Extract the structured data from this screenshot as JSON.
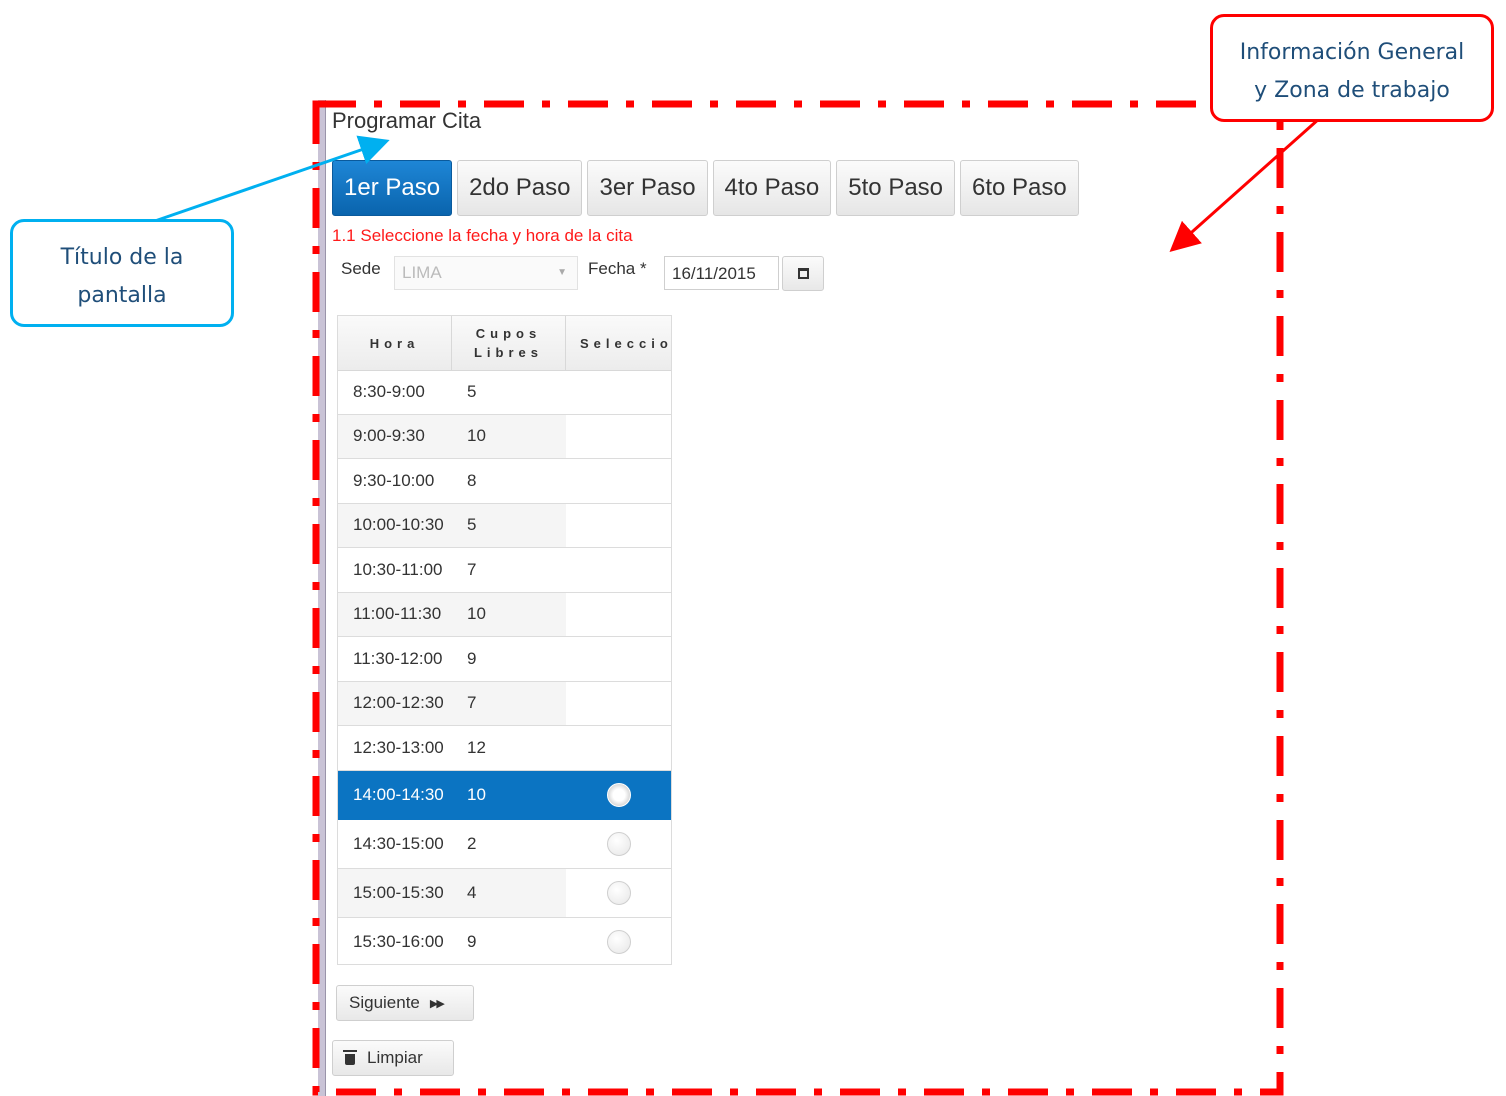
{
  "screen": {
    "title": "Programar Cita",
    "tabs": [
      {
        "label": "1er Paso",
        "active": true
      },
      {
        "label": "2do Paso"
      },
      {
        "label": "3er Paso"
      },
      {
        "label": "4to Paso"
      },
      {
        "label": "5to Paso"
      },
      {
        "label": "6to Paso"
      }
    ],
    "instruction": "1.1 Seleccione la fecha y hora de la cita",
    "sede": {
      "label": "Sede",
      "value": "LIMA"
    },
    "fecha": {
      "label": "Fecha *",
      "value": "16/11/2015"
    },
    "table": {
      "headers": [
        "Hora",
        "Cupos Libres",
        "Seleccio"
      ],
      "rows": [
        {
          "hora": "8:30-9:00",
          "cupos": "5"
        },
        {
          "hora": "9:00-9:30",
          "cupos": "10"
        },
        {
          "hora": "9:30-10:00",
          "cupos": "8"
        },
        {
          "hora": "10:00-10:30",
          "cupos": "5"
        },
        {
          "hora": "10:30-11:00",
          "cupos": "7"
        },
        {
          "hora": "11:00-11:30",
          "cupos": "10"
        },
        {
          "hora": "11:30-12:00",
          "cupos": "9"
        },
        {
          "hora": "12:00-12:30",
          "cupos": "7"
        },
        {
          "hora": "12:30-13:00",
          "cupos": "12"
        },
        {
          "hora": "14:00-14:30",
          "cupos": "10",
          "radio": true,
          "selected": true
        },
        {
          "hora": "14:30-15:00",
          "cupos": "2",
          "radio": true
        },
        {
          "hora": "15:00-15:30",
          "cupos": "4",
          "radio": true
        },
        {
          "hora": "15:30-16:00",
          "cupos": "9",
          "radio": true
        }
      ]
    },
    "next_button": "Siguiente",
    "clear_button": "Limpiar"
  },
  "annotations": {
    "title_callout": [
      "Título de la",
      "pantalla"
    ],
    "zone_callout": [
      "Información General",
      "y Zona de trabajo"
    ]
  },
  "colors": {
    "active_tab": "#0a64ad",
    "instruction": "#ff1a1a",
    "selected_row": "#0b74c2",
    "zone_border": "#ff0000",
    "title_callout": "#00b0f0",
    "zone_callout_text": "#1f4e79"
  }
}
